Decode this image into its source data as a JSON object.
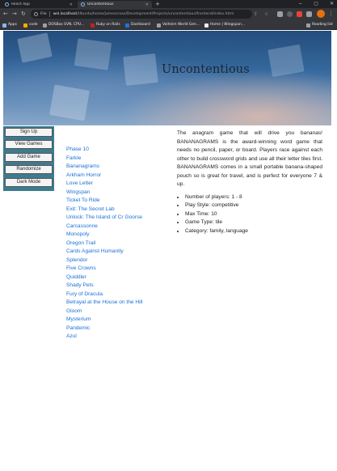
{
  "browser": {
    "tabs": [
      {
        "title": "React App",
        "active": false
      },
      {
        "title": "Uncontentious",
        "active": true
      }
    ],
    "new_tab": "+",
    "window_controls": [
      "−",
      "▢",
      "✕"
    ],
    "nav": {
      "back": "←",
      "forward": "→",
      "reload": "↻"
    },
    "address": {
      "scheme": "File",
      "host": "wsl.localhost",
      "path": "/Ubuntu/home/jamescross/Development/Projects/uncontentious/frontend/index.html"
    },
    "bookmarks": [
      {
        "label": "Apps",
        "icon": "apps-grid-icon",
        "color": "#8ab4f8"
      },
      {
        "label": "code",
        "icon": "folder-icon",
        "color": "#f9ab00"
      },
      {
        "label": "DOSBox SVN, CPU...",
        "icon": "dosbox-icon",
        "color": "#9aa0a6"
      },
      {
        "label": "Ruby on Rails",
        "icon": "rails-icon",
        "color": "#c5221f"
      },
      {
        "label": "Dashboard",
        "icon": "dashboard-icon",
        "color": "#1a73e8"
      },
      {
        "label": "Valheim World Gen...",
        "icon": "valheim-icon",
        "color": "#9aa0a6"
      },
      {
        "label": "Home | Wingspan...",
        "icon": "wingspan-icon",
        "color": "#e8eaed"
      }
    ],
    "reading_list": "Reading list"
  },
  "header": {
    "title": "Uncontentious"
  },
  "sidebar": {
    "buttons": [
      "Sign Up",
      "View Games",
      "Add Game",
      "Randomize",
      "Dark Mode"
    ]
  },
  "games": [
    "Phase 10",
    "Farkle",
    "Bananagrams",
    "Arkham Horror",
    "Love Letter",
    "Wingspan",
    "Ticket To Ride",
    "Exit: The Secret Lab",
    "Unlock: The Island of Cr Goorse",
    "Carcassonne",
    "Monopoly",
    "Oregon Trail",
    "Cards Against Humanity",
    "Splendor",
    "Five Crowns",
    "Quiddler",
    "Shady Pets",
    "Fury of Dracula",
    "Betrayal at the House on the Hill",
    "Gloom",
    "Mysterium",
    "Pandemic",
    "Azul"
  ],
  "details": {
    "description": "The anagram game that will drive you bananas! BANANAGRAMS is the award-winning word game that needs no pencil, paper, or board. Players race against each other to build crossword grids and use all their letter tiles first. BANANAGRAMS comes in a small portable banana-shaped pouch so is great for travel, and is perfect for everyone 7 & up.",
    "facts": [
      "Number of players: 1 - 8",
      "Play Style: competitive",
      "Max Time: 10",
      "Game Type: tile",
      "Category: family, language"
    ]
  },
  "colors": {
    "sidebar": "#3c7b90",
    "link": "#1a6fd6",
    "chrome_dark": "#202124",
    "chrome_toolbar": "#35363a"
  }
}
